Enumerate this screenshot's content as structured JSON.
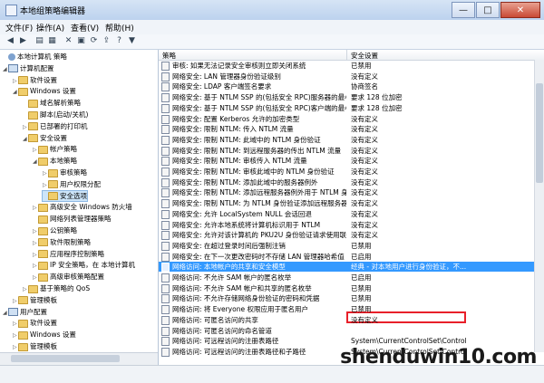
{
  "window": {
    "title": "本地组策略编辑器",
    "min": "—",
    "max": "□",
    "close": "✕"
  },
  "menus": [
    "文件(F)",
    "操作(A)",
    "查看(V)",
    "帮助(H)"
  ],
  "toolbar_icons": [
    "back-icon",
    "forward-icon",
    "up-folder-icon",
    "show-hide-tree-icon",
    "delete-icon",
    "properties-icon",
    "refresh-icon",
    "export-icon",
    "help-icon",
    "filter-icon"
  ],
  "tree": [
    {
      "label": "本地计算机 策略",
      "level": 0,
      "exp": "",
      "icon": "policy"
    },
    {
      "label": "计算机配置",
      "level": 0,
      "exp": "◢",
      "icon": "computer"
    },
    {
      "label": "软件设置",
      "level": 1,
      "exp": "▷",
      "icon": "folder"
    },
    {
      "label": "Windows 设置",
      "level": 1,
      "exp": "◢",
      "icon": "folder"
    },
    {
      "label": "域名解析策略",
      "level": 2,
      "exp": "",
      "icon": "folder"
    },
    {
      "label": "脚本(启动/关机)",
      "level": 2,
      "exp": "",
      "icon": "folder"
    },
    {
      "label": "已部署的打印机",
      "level": 2,
      "exp": "▷",
      "icon": "folder"
    },
    {
      "label": "安全设置",
      "level": 2,
      "exp": "◢",
      "icon": "folder"
    },
    {
      "label": "帐户策略",
      "level": 3,
      "exp": "▷",
      "icon": "folder"
    },
    {
      "label": "本地策略",
      "level": 3,
      "exp": "◢",
      "icon": "folder"
    },
    {
      "label": "审核策略",
      "level": 4,
      "exp": "▷",
      "icon": "folder"
    },
    {
      "label": "用户权限分配",
      "level": 4,
      "exp": "▷",
      "icon": "folder"
    },
    {
      "label": "安全选项",
      "level": 4,
      "exp": "",
      "icon": "folder",
      "selected": true
    },
    {
      "label": "高级安全 Windows 防火墙",
      "level": 3,
      "exp": "▷",
      "icon": "folder"
    },
    {
      "label": "网络列表管理器策略",
      "level": 3,
      "exp": "",
      "icon": "folder"
    },
    {
      "label": "公钥策略",
      "level": 3,
      "exp": "▷",
      "icon": "folder"
    },
    {
      "label": "软件限制策略",
      "level": 3,
      "exp": "▷",
      "icon": "folder"
    },
    {
      "label": "应用程序控制策略",
      "level": 3,
      "exp": "▷",
      "icon": "folder"
    },
    {
      "label": "IP 安全策略，在 本地计算机",
      "level": 3,
      "exp": "▷",
      "icon": "folder"
    },
    {
      "label": "高级审核策略配置",
      "level": 3,
      "exp": "▷",
      "icon": "folder"
    },
    {
      "label": "基于策略的 QoS",
      "level": 2,
      "exp": "▷",
      "icon": "folder"
    },
    {
      "label": "管理模板",
      "level": 1,
      "exp": "▷",
      "icon": "folder"
    },
    {
      "label": "用户配置",
      "level": 0,
      "exp": "◢",
      "icon": "computer"
    },
    {
      "label": "软件设置",
      "level": 1,
      "exp": "▷",
      "icon": "folder"
    },
    {
      "label": "Windows 设置",
      "level": 1,
      "exp": "▷",
      "icon": "folder"
    },
    {
      "label": "管理模板",
      "level": 1,
      "exp": "▷",
      "icon": "folder"
    }
  ],
  "list": {
    "headers": {
      "policy": "策略",
      "setting": "安全设置"
    },
    "rows": [
      {
        "policy": "审核: 如果无法记录安全审核则立即关闭系统",
        "setting": "已禁用"
      },
      {
        "policy": "网络安全: LAN 管理器身份验证级别",
        "setting": "没有定义"
      },
      {
        "policy": "网络安全: LDAP 客户端签名要求",
        "setting": "协商签名"
      },
      {
        "policy": "网络安全: 基于 NTLM SSP 的(包括安全 RPC)服务器的最小...",
        "setting": "要求 128 位加密"
      },
      {
        "policy": "网络安全: 基于 NTLM SSP 的(包括安全 RPC)客户端的最小...",
        "setting": "要求 128 位加密"
      },
      {
        "policy": "网络安全: 配置 Kerberos 允许的加密类型",
        "setting": "没有定义"
      },
      {
        "policy": "网络安全: 限制 NTLM: 传入 NTLM 流量",
        "setting": "没有定义"
      },
      {
        "policy": "网络安全: 限制 NTLM: 此域中的 NTLM 身份验证",
        "setting": "没有定义"
      },
      {
        "policy": "网络安全: 限制 NTLM: 到远程服务器的传出 NTLM 流量",
        "setting": "没有定义"
      },
      {
        "policy": "网络安全: 限制 NTLM: 审核传入 NTLM 流量",
        "setting": "没有定义"
      },
      {
        "policy": "网络安全: 限制 NTLM: 审核此域中的 NTLM 身份验证",
        "setting": "没有定义"
      },
      {
        "policy": "网络安全: 限制 NTLM: 添加此域中的服务器例外",
        "setting": "没有定义"
      },
      {
        "policy": "网络安全: 限制 NTLM: 添加远程服务器例外用于 NTLM 身...",
        "setting": "没有定义"
      },
      {
        "policy": "网络安全: 限制 NTLM: 为 NTLM 身份验证添加远程服务器例外",
        "setting": "没有定义"
      },
      {
        "policy": "网络安全: 允许 LocalSystem NULL 会话回退",
        "setting": "没有定义"
      },
      {
        "policy": "网络安全: 允许本地系统将计算机标识用于 NTLM",
        "setting": "没有定义"
      },
      {
        "policy": "网络安全: 允许对该计算机的 PKU2U 身份验证请求使用联机标识",
        "setting": "没有定义"
      },
      {
        "policy": "网络安全: 在超过登录时间后强制注销",
        "setting": "已禁用"
      },
      {
        "policy": "网络安全: 在下一次更改密码时不存储 LAN 管理器哈希值",
        "setting": "已启用"
      },
      {
        "policy": "网络访问: 本地帐户的共享和安全模型",
        "setting": "经典 - 对本地用户进行身份验证，不...",
        "selected": true
      },
      {
        "policy": "网络访问: 不允许 SAM 帐户的匿名枚举",
        "setting": "已启用"
      },
      {
        "policy": "网络访问: 不允许 SAM 帐户和共享的匿名枚举",
        "setting": "已禁用"
      },
      {
        "policy": "网络访问: 不允许存储网络身份验证的密码和凭据",
        "setting": "已禁用"
      },
      {
        "policy": "网络访问: 将 Everyone 权限应用于匿名用户",
        "setting": "已禁用"
      },
      {
        "policy": "网络访问: 可匿名访问的共享",
        "setting": "没有定义"
      },
      {
        "policy": "网络访问: 可匿名访问的命名管道",
        "setting": ""
      },
      {
        "policy": "网络访问: 可远程访问的注册表路径",
        "setting": "System\\CurrentControlSet\\Control"
      },
      {
        "policy": "网络访问: 可远程访问的注册表路径和子路径",
        "setting": "System\\CurrentControlSet\\Control"
      }
    ]
  },
  "watermark": "shenduwin10.com"
}
